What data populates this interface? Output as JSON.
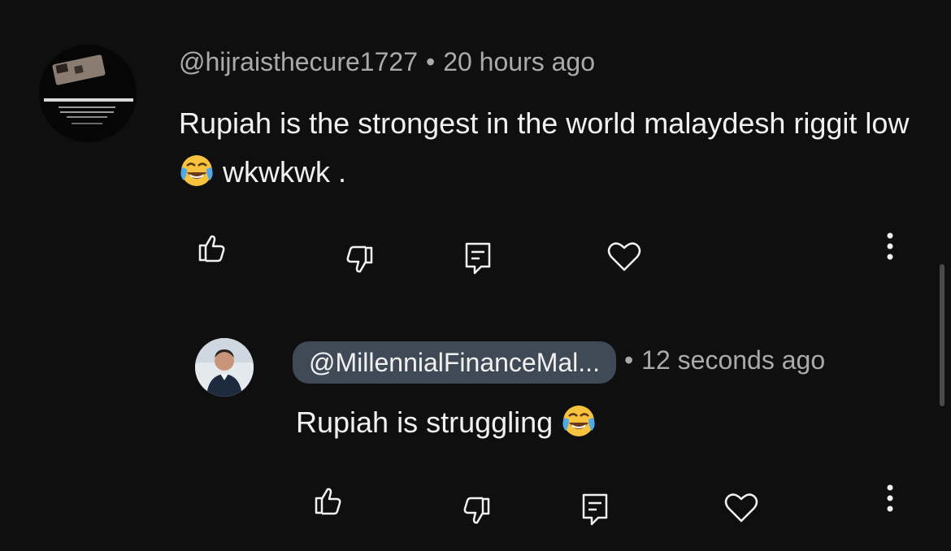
{
  "comments": [
    {
      "handle": "@hijraisthecure1727",
      "separator": "•",
      "time": "20 hours ago",
      "text_before_emoji": "Rupiah is the strongest in the world malaydesh riggit low",
      "emoji": "face-with-tears-of-joy",
      "text_after_emoji": "wkwkwk ."
    }
  ],
  "reply": {
    "handle": "@MillennialFinanceMal...",
    "separator": "•",
    "time": "12 seconds ago",
    "text_before_emoji": "Rupiah is struggling",
    "emoji": "face-with-tears-of-joy"
  },
  "actions": [
    "like",
    "dislike",
    "reply",
    "heart",
    "more"
  ],
  "colors": {
    "background": "#0f0f0f",
    "text": "#f1f1f1",
    "meta": "#aaaaaa",
    "handle_pill": "#3f4a56"
  }
}
